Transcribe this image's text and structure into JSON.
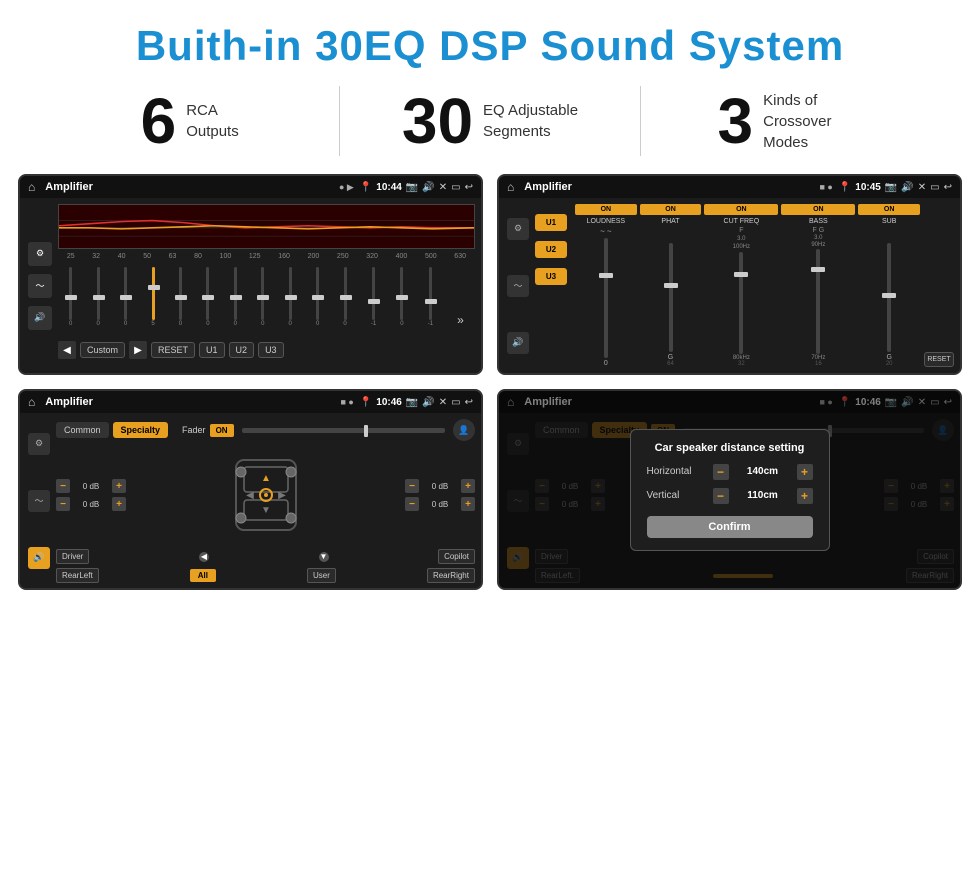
{
  "header": {
    "title": "Buith-in 30EQ DSP Sound System"
  },
  "stats": [
    {
      "number": "6",
      "description": "RCA\nOutputs"
    },
    {
      "number": "30",
      "description": "EQ Adjustable\nSegments"
    },
    {
      "number": "3",
      "description": "Kinds of\nCrossover Modes"
    }
  ],
  "screens": {
    "screen1": {
      "app_name": "Amplifier",
      "time": "10:44",
      "freq_labels": [
        "25",
        "32",
        "40",
        "50",
        "63",
        "80",
        "100",
        "125",
        "160",
        "200",
        "250",
        "320",
        "400",
        "500",
        "630"
      ],
      "slider_vals": [
        "0",
        "0",
        "0",
        "5",
        "0",
        "0",
        "0",
        "0",
        "0",
        "0",
        "0",
        "-1",
        "0",
        "-1"
      ],
      "buttons": [
        "Custom",
        "RESET",
        "U1",
        "U2",
        "U3"
      ]
    },
    "screen2": {
      "app_name": "Amplifier",
      "time": "10:45",
      "presets": [
        "U1",
        "U2",
        "U3"
      ],
      "channels": [
        {
          "toggle": "ON",
          "label": "LOUDNESS"
        },
        {
          "toggle": "ON",
          "label": "PHAT"
        },
        {
          "toggle": "ON",
          "label": "CUT FREQ"
        },
        {
          "toggle": "ON",
          "label": "BASS"
        },
        {
          "toggle": "ON",
          "label": "SUB"
        }
      ],
      "reset_btn": "RESET"
    },
    "screen3": {
      "app_name": "Amplifier",
      "time": "10:46",
      "tabs": [
        "Common",
        "Specialty"
      ],
      "fader_label": "Fader",
      "on_btn": "ON",
      "volumes": [
        "0 dB",
        "0 dB",
        "0 dB",
        "0 dB"
      ],
      "labels": {
        "driver": "Driver",
        "copilot": "Copilot",
        "rear_left": "RearLeft",
        "all": "All",
        "user": "User",
        "rear_right": "RearRight"
      }
    },
    "screen4": {
      "app_name": "Amplifier",
      "time": "10:46",
      "tabs": [
        "Common",
        "Specialty"
      ],
      "on_btn": "ON",
      "dialog": {
        "title": "Car speaker distance setting",
        "horizontal_label": "Horizontal",
        "horizontal_value": "140cm",
        "vertical_label": "Vertical",
        "vertical_value": "110cm",
        "confirm_btn": "Confirm"
      },
      "labels": {
        "driver": "Driver",
        "copilot": "Copilot",
        "rear_left": "RearLeft.",
        "rear_right": "RearRight"
      }
    }
  }
}
